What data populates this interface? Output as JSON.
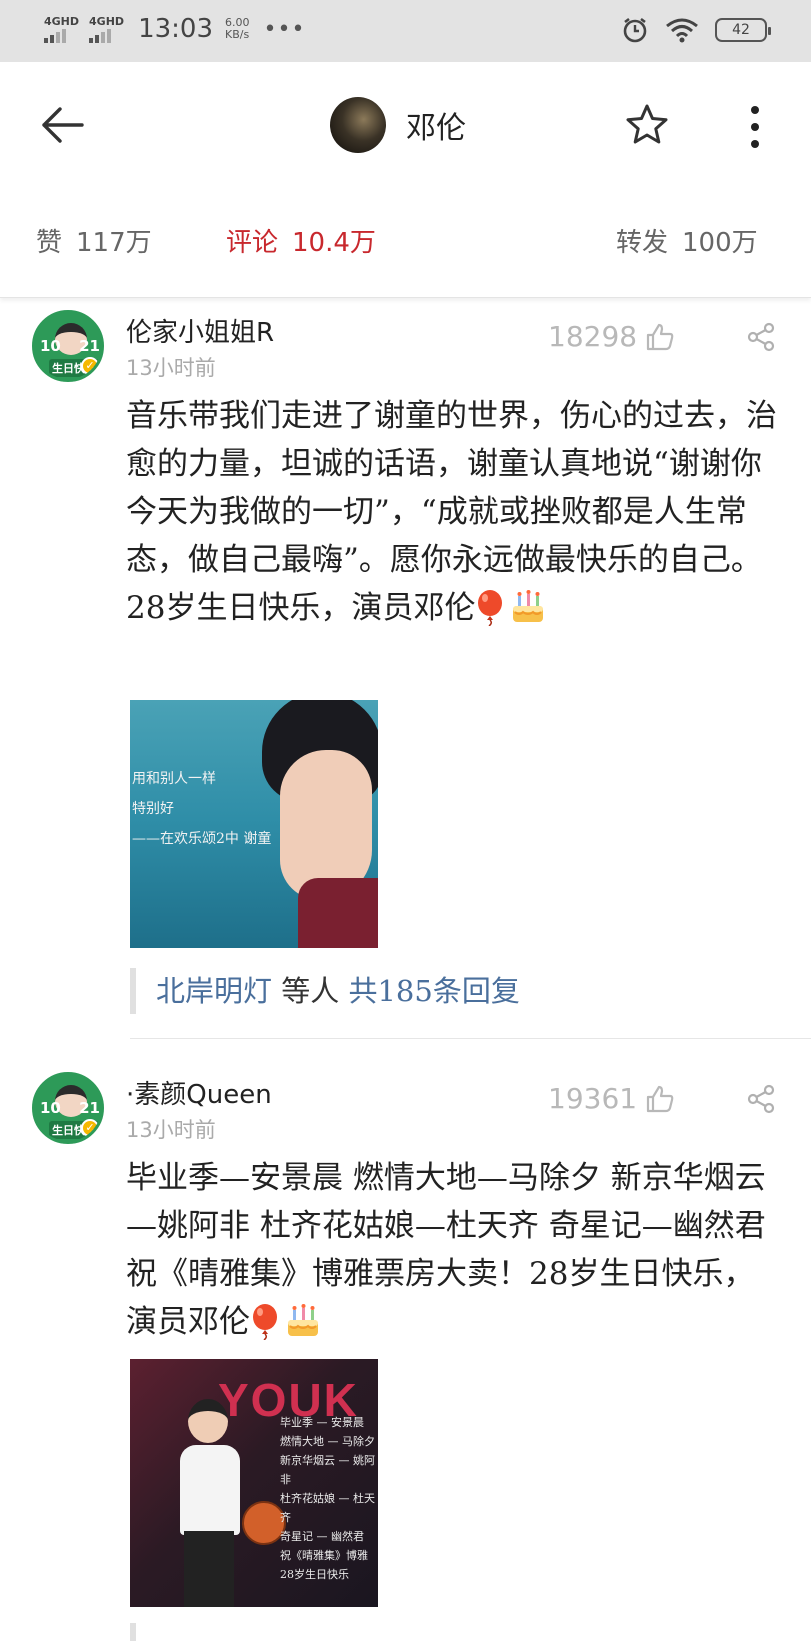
{
  "status_bar": {
    "signal1": "4GHD",
    "signal2": "4GHD",
    "time": "13:03",
    "speed_value": "6.00",
    "speed_unit": "KB/s",
    "more": "•••",
    "battery": "42"
  },
  "header": {
    "title": "邓伦"
  },
  "stats": {
    "likes_label": "赞",
    "likes_count": "117万",
    "comments_label": "评论",
    "comments_count": "10.4万",
    "reposts_label": "转发",
    "reposts_count": "100万"
  },
  "comments": [
    {
      "username": "伦家小姐姐R",
      "time": "13小时前",
      "likes": "18298",
      "avatar_badge_left": "10",
      "avatar_badge_right": "21",
      "avatar_tag": "生日快乐",
      "text": "音乐带我们走进了谢童的世界，伤心的过去，治愈的力量，坦诚的话语，谢童认真地说“谢谢你今天为我做的一切”，“成就或挫败都是人生常态，做自己最嗨”。愿你永远做最快乐的自己。28岁生日快乐，演员邓伦",
      "image_text": [
        "用和别人一样",
        "特别好",
        "——在欢乐颂2中 谢童"
      ],
      "reply_users": "北岸明灯",
      "reply_mid": "等人",
      "reply_count": "共185条回复"
    },
    {
      "username": "·素颜Queen",
      "time": "13小时前",
      "likes": "19361",
      "avatar_badge_left": "10",
      "avatar_badge_right": "21",
      "avatar_tag": "生日快乐",
      "text": "毕业季—安景晨 燃情大地—马除夕 新京华烟云—姚阿非 杜齐花姑娘—杜天齐 奇星记—幽然君 祝《晴雅集》博雅票房大卖！28岁生日快乐，演员邓伦",
      "image_brand": "YOUK",
      "image_text": [
        "毕业季 — 安景晨",
        "燃情大地 — 马除夕",
        "新京华烟云 — 姚阿非",
        "杜齐花姑娘 — 杜天齐",
        "奇星记 — 幽然君",
        "祝《晴雅集》博雅",
        "28岁生日快乐"
      ]
    }
  ],
  "colors": {
    "accent_red": "#c8282d",
    "link_blue": "#4a6f9c",
    "status_bar_bg": "#e3e3e3"
  },
  "icons": [
    "back-arrow-icon",
    "star-icon",
    "more-vertical-icon",
    "thumbs-up-icon",
    "share-icon",
    "balloon-emoji-icon",
    "cake-emoji-icon",
    "alarm-icon",
    "wifi-icon",
    "battery-icon"
  ]
}
